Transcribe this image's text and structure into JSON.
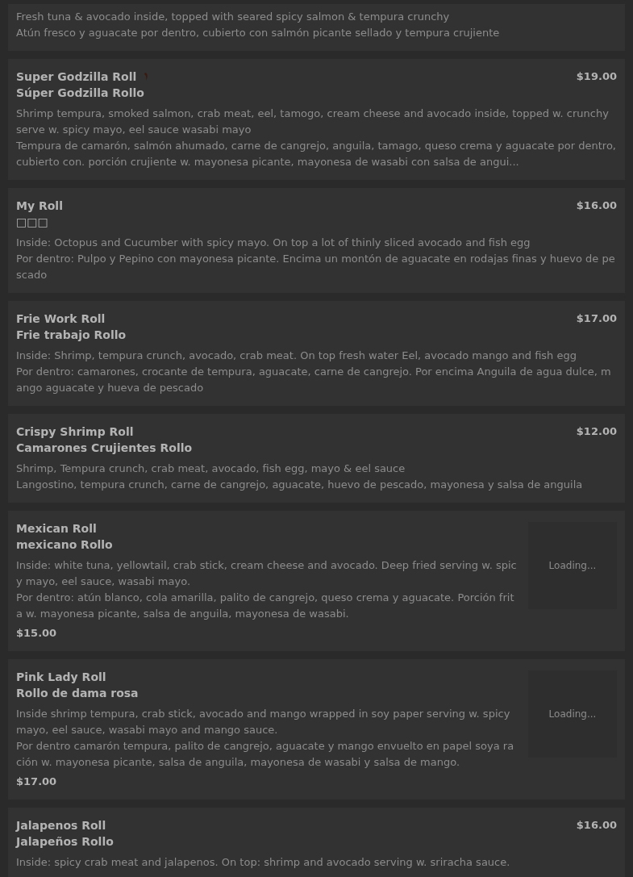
{
  "items": [
    {
      "kind": "row",
      "description": [
        "Fresh tuna & avocado inside, topped with seared spicy salmon & tempura crunchy",
        "Atún fresco y aguacate por dentro, cubierto con salmón picante sellado y tempura crujiente"
      ]
    },
    {
      "kind": "row",
      "name": "Super Godzilla Roll",
      "spicy": true,
      "subtitle": "Súper Godzilla Rollo",
      "price": "$19.00",
      "description": [
        "Shrimp tempura, smoked salmon, crab meat, eel, tamogo, cream cheese and avocado inside, topped w. crunchy serve w. spicy mayo, eel sauce wasabi mayo",
        "Tempura de camarón, salmón ahumado, carne de cangrejo, anguila, tamago, queso crema y aguacate por dentro, cubierto con. porción crujiente w. mayonesa picante, mayonesa de wasabi con salsa de angui..."
      ]
    },
    {
      "kind": "row",
      "name": "My Roll",
      "spicy": false,
      "subtitle": "□□□",
      "price": "$16.00",
      "description": [
        "Inside: Octopus and Cucumber with spicy mayo. On top a lot of thinly sliced avocado and fish egg",
        "Por dentro: Pulpo y Pepino con mayonesa picante. Encima un montón de aguacate en rodajas finas y huevo de pescado"
      ]
    },
    {
      "kind": "row",
      "name": "Frie Work Roll",
      "spicy": false,
      "subtitle": "Frie trabajo Rollo",
      "price": "$17.00",
      "description": [
        "Inside: Shrimp, tempura crunch, avocado, crab meat. On top fresh water Eel, avocado mango and fish egg",
        "Por dentro: camarones, crocante de tempura, aguacate, carne de cangrejo. Por encima Anguila de agua dulce, mango aguacate y hueva de pescado"
      ]
    },
    {
      "kind": "row",
      "name": "Crispy Shrimp Roll",
      "spicy": false,
      "subtitle": "Camarones Crujientes Rollo",
      "price": "$12.00",
      "description": [
        "Shrimp, Tempura crunch, crab meat, avocado, fish egg, mayo & eel sauce",
        "Langostino, tempura crunch, carne de cangrejo, aguacate, huevo de pescado, mayonesa y salsa de anguila"
      ]
    },
    {
      "kind": "image",
      "name": "Mexican Roll",
      "spicy": false,
      "subtitle": "mexicano Rollo",
      "price": "$15.00",
      "image_status": "Loading...",
      "description": [
        "Inside: white tuna, yellowtail, crab stick, cream cheese and avocado. Deep fried serving w. spicy mayo, eel sauce, wasabi mayo.",
        "Por dentro: atún blanco, cola amarilla, palito de cangrejo, queso crema y aguacate. Porción frita w. mayonesa picante, salsa de anguila, mayonesa de wasabi."
      ]
    },
    {
      "kind": "image",
      "name": "Pink Lady Roll",
      "spicy": false,
      "subtitle": "Rollo de dama rosa",
      "price": "$17.00",
      "image_status": "Loading...",
      "description": [
        "Inside shrimp tempura, crab stick, avocado and mango wrapped in soy paper serving w. spicy mayo, eel sauce, wasabi mayo and mango sauce.",
        "Por dentro camarón tempura, palito de cangrejo, aguacate y mango envuelto en papel soya ración w. mayonesa picante, salsa de anguila, mayonesa de wasabi y salsa de mango."
      ]
    },
    {
      "kind": "row",
      "name": "Jalapenos Roll",
      "spicy": false,
      "subtitle": "Jalapeños Rollo",
      "price": "$16.00",
      "description": [
        "Inside: spicy crab meat and jalapenos. On top: shrimp and avocado serving w. sriracha sauce."
      ]
    }
  ]
}
